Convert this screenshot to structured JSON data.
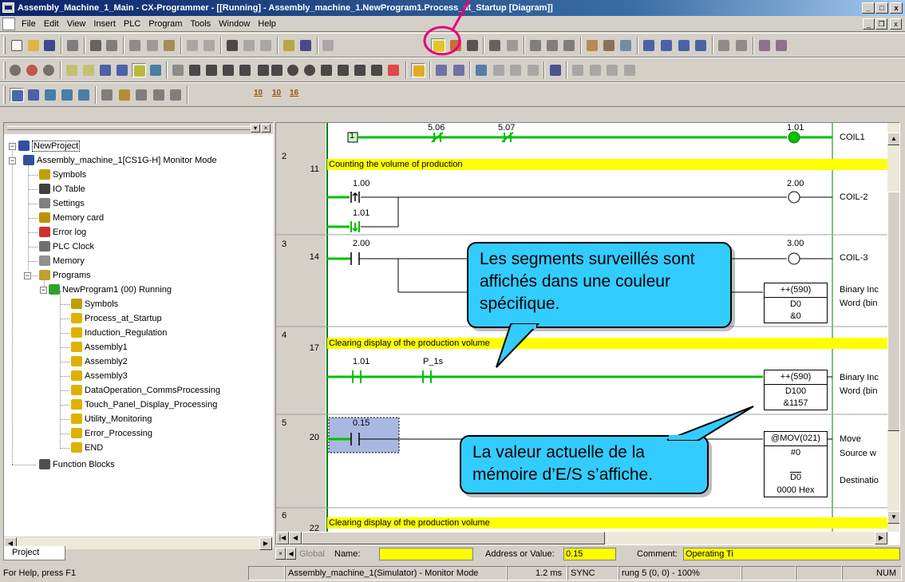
{
  "window": {
    "title": "Assembly_Machine_1_Main - CX-Programmer - [[Running] - Assembly_machine_1.NewProgram1.Process_at_Startup [Diagram]]",
    "minimize": "_",
    "maximize": "□",
    "close": "x"
  },
  "menu": {
    "items": [
      "File",
      "Edit",
      "View",
      "Insert",
      "PLC",
      "Program",
      "Tools",
      "Window",
      "Help"
    ],
    "mdi_minimize": "_",
    "mdi_restore": "❐",
    "mdi_close": "x"
  },
  "toolbar_row3": {
    "z1": "10",
    "z2": "10",
    "z3": "16"
  },
  "project_tree": {
    "root": "NewProject",
    "plc": "Assembly_machine_1[CS1G-H] Monitor Mode",
    "plc_children": [
      "Symbols",
      "IO Table",
      "Settings",
      "Memory card",
      "Error log",
      "PLC Clock",
      "Memory",
      "Programs"
    ],
    "program": "NewProgram1 (00) Running",
    "program_children": [
      "Symbols",
      "Process_at_Startup",
      "Induction_Regulation",
      "Assembly1",
      "Assembly2",
      "Assembly3",
      "DataOperation_CommsProcessing",
      "Touch_Panel_Display_Processing",
      "Utility_Monitoring",
      "Error_Processing",
      "END"
    ],
    "function_blocks": "Function Blocks",
    "tab": "Project"
  },
  "ladder": {
    "rung1": {
      "step_box": "1",
      "contact1": "5.06",
      "contact2": "5.07",
      "coil": "1.01",
      "coil_comment": "COIL1"
    },
    "rung2": {
      "rung": "2",
      "step": "11",
      "comment": "Counting the volume of production",
      "c1": "1.00",
      "c2": "1.01",
      "coil": "2.00",
      "coil_comment": "COIL-2"
    },
    "rung3": {
      "rung": "3",
      "step": "14",
      "c1": "2.00",
      "coil": "3.00",
      "coil_comment": "COIL-3",
      "instr": "++(590)",
      "operand": "D0",
      "value": "&0",
      "instr_comment": "Binary Inc",
      "operand_comment": "Word (bin"
    },
    "rung4": {
      "rung": "4",
      "step": "17",
      "comment": "Clearing display of the production volume",
      "c1": "1.01",
      "c2": "P_1s",
      "instr": "++(590)",
      "operand": "D100",
      "value": "&1157",
      "instr_comment": "Binary Inc",
      "operand_comment": "Word (bin"
    },
    "rung5": {
      "rung": "5",
      "step": "20",
      "c1": "0.15",
      "instr": "@MOV(021)",
      "src": "#0",
      "dst": "D0",
      "dst_value": "0000 Hex",
      "instr_comment": "Move",
      "src_comment": "Source w",
      "dst_comment": "Destinatio"
    },
    "rung6": {
      "rung": "6",
      "step": "22",
      "comment": "Clearing display of the production volume"
    }
  },
  "callouts": {
    "monitored": "Les segments surveillés sont affichés dans une couleur spécifique.",
    "current_value": "La valeur actuelle de la mémoire d’E/S s’affiche."
  },
  "nav": {
    "global_tab": "Global",
    "name_label": "Name:",
    "name_value": "",
    "address_label": "Address or Value:",
    "address_value": "0.15",
    "comment_label": "Comment:",
    "comment_value": "Operating Ti"
  },
  "status": {
    "help": "For Help, press F1",
    "plc": "Assembly_machine_1(Simulator) - Monitor Mode",
    "cycle": "1.2 ms",
    "sync": "SYNC",
    "position": "rung 5 (0, 0)  - 100%",
    "num": "NUM"
  },
  "colors": {
    "monitor_green": "#00c000",
    "comment_yellow": "#ffff00",
    "callout_blue": "#33ccff",
    "highlight_ring": "#e6007e"
  }
}
